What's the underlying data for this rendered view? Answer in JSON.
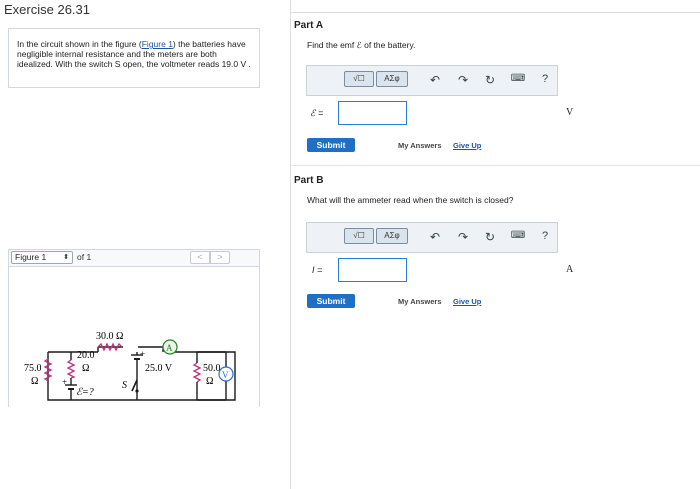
{
  "exercise": {
    "title": "Exercise 26.31",
    "statement_pre": "In the circuit shown in the figure (",
    "figure_link": "Figure 1",
    "statement_post": ") the batteries have negligible internal resistance and the meters are both idealized. With the switch S open, the voltmeter reads 19.0 V ."
  },
  "figure_nav": {
    "selected": "Figure 1",
    "of_text": "of 1",
    "prev_glyph": "<",
    "next_glyph": ">"
  },
  "circuit": {
    "r_top": "30.0 Ω",
    "r_mid_value": "20.0",
    "r_mid_unit": "Ω",
    "r_left_value": "75.0",
    "r_left_unit": "Ω",
    "r_right_value": "50.0",
    "r_right_unit": "Ω",
    "battery_voltage": "25.0 V",
    "emf_label": "ℰ=?",
    "switch_label": "S",
    "ammeter_label": "A",
    "voltmeter_label": "V",
    "plus": "+"
  },
  "toolbar": {
    "template_label": "√☐",
    "greek_label": "ΑΣφ",
    "undo_icon": "undo-icon",
    "redo_icon": "redo-icon",
    "reset_icon": "reset-icon",
    "keyboard_icon": "keyboard-icon",
    "help_label": "?"
  },
  "part_a": {
    "title": "Part A",
    "prompt": "Find the emf ℰ of the battery.",
    "var_label": "ℰ =",
    "answer_value": "",
    "unit": "V",
    "submit": "Submit",
    "my_answers": "My Answers",
    "give_up": "Give Up"
  },
  "part_b": {
    "title": "Part B",
    "prompt": "What will the ammeter read when the switch is closed?",
    "var_label": "I =",
    "answer_value": "",
    "unit": "A",
    "submit": "Submit",
    "my_answers": "My Answers",
    "give_up": "Give Up"
  }
}
